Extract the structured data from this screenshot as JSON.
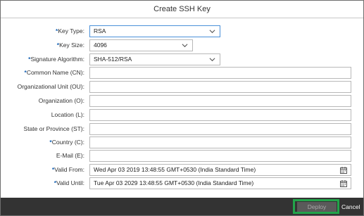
{
  "dialog": {
    "title": "Create SSH Key"
  },
  "form": {
    "required_marker": "*",
    "key_type": {
      "label": "Key Type:",
      "value": "RSA"
    },
    "key_size": {
      "label": "Key Size:",
      "value": "4096"
    },
    "signature_algorithm": {
      "label": "Signature Algorithm:",
      "value": "SHA-512/RSA"
    },
    "common_name": {
      "label": "Common Name (CN):",
      "value": ""
    },
    "organizational_unit": {
      "label": "Organizational Unit (OU):",
      "value": ""
    },
    "organization": {
      "label": "Organization (O):",
      "value": ""
    },
    "location": {
      "label": "Location (L):",
      "value": ""
    },
    "state_or_province": {
      "label": "State or Province (ST):",
      "value": ""
    },
    "country": {
      "label": "Country (C):",
      "value": ""
    },
    "email": {
      "label": "E-Mail (E):",
      "value": ""
    },
    "valid_from": {
      "label": "Valid From:",
      "value": "Wed Apr 03 2019 13:48:55 GMT+0530 (India Standard Time)"
    },
    "valid_until": {
      "label": "Valid Until:",
      "value": "Tue Apr 03 2029 13:48:55 GMT+0530 (India Standard Time)"
    }
  },
  "footer": {
    "deploy_label": "Deploy",
    "cancel_label": "Cancel"
  },
  "icons": {
    "dropdown": "chevron-down-icon",
    "date_picker": "calendar-icon"
  },
  "colors": {
    "required_marker": "#1a64b4",
    "highlight": "#22a34a",
    "footer_bg": "#333333",
    "focus_border": "#4a90d9"
  }
}
